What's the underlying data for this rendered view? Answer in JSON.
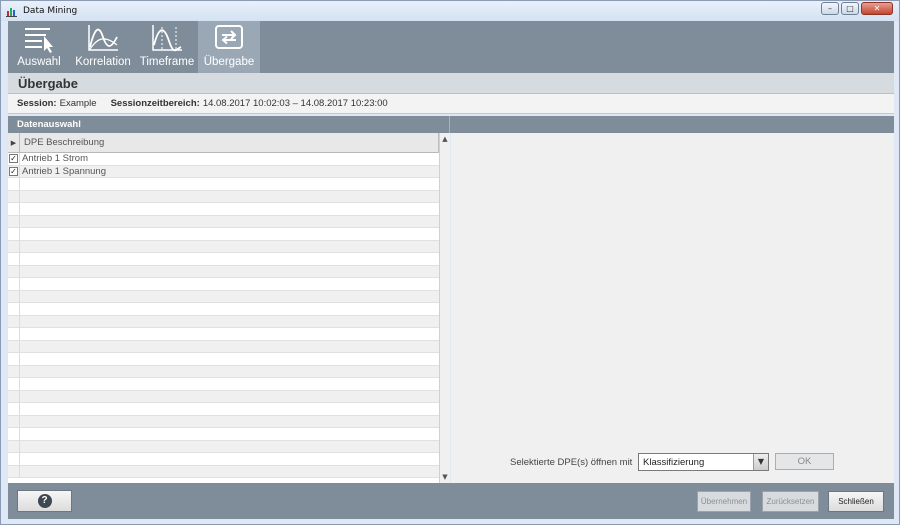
{
  "window": {
    "title": "Data Mining"
  },
  "toolbar": {
    "items": [
      {
        "label": "Auswahl",
        "icon": "selection-list-icon"
      },
      {
        "label": "Korrelation",
        "icon": "correlation-curve-icon"
      },
      {
        "label": "Timeframe",
        "icon": "timeframe-curve-icon"
      },
      {
        "label": "Übergabe",
        "icon": "handover-arrows-icon",
        "active": true
      }
    ]
  },
  "header": {
    "title": "Übergabe"
  },
  "session": {
    "session_label": "Session:",
    "session_value": "Example",
    "range_label": "Sessionzeitbereich:",
    "range_value": "14.08.2017 10:02:03 – 14.08.2017 10:23:00"
  },
  "section": {
    "title": "Datenauswahl"
  },
  "table": {
    "column": "DPE Beschreibung",
    "rows": [
      {
        "label": "Antrieb 1 Strom",
        "checked": true
      },
      {
        "label": "Antrieb 1 Spannung",
        "checked": true
      }
    ]
  },
  "open_with": {
    "label": "Selektierte DPE(s) öffnen mit",
    "selected": "Klassifizierung",
    "ok_label": "OK"
  },
  "footer": {
    "help_label": "?",
    "apply_label": "Übernehmen",
    "reset_label": "Zurücksetzen",
    "close_label": "Schließen"
  },
  "colors": {
    "toolbar_bg": "#7f8c99",
    "active_tool_bg": "#9aa7b4",
    "header_bg": "#d6dbe0",
    "right_panel_bg": "#f0f0f0"
  }
}
